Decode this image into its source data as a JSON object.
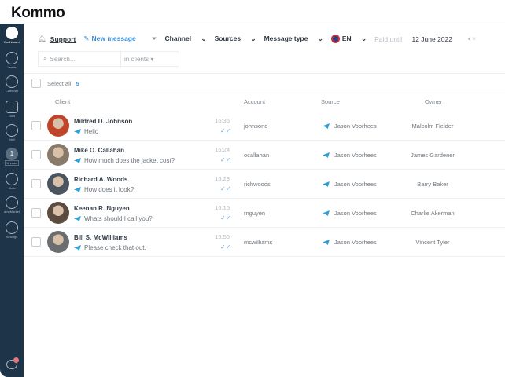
{
  "brand": {
    "logo": "Kommo"
  },
  "sidebar": {
    "items": [
      {
        "label": "Dashboard",
        "icon": "dashboard-icon"
      },
      {
        "label": "Leads",
        "icon": "leads-icon"
      },
      {
        "label": "Calendar",
        "icon": "calendar-icon"
      },
      {
        "label": "Lists",
        "icon": "lists-icon"
      },
      {
        "label": "Mail",
        "icon": "mail-icon"
      },
      {
        "label": "Unread",
        "icon": "unread-icon",
        "badge": "1"
      },
      {
        "label": "Stats",
        "icon": "stats-icon"
      },
      {
        "label": "amoMarket",
        "icon": "market-icon"
      },
      {
        "label": "Settings",
        "icon": "settings-icon"
      }
    ],
    "chat_badge": "1"
  },
  "toolbar": {
    "support": "Support",
    "new_message": "New message",
    "channel": "Channel",
    "sources": "Sources",
    "message_type": "Message type",
    "language": "EN",
    "paid_label": "Paid until",
    "paid_date": "12 June 2022"
  },
  "search": {
    "placeholder": "Search...",
    "scope": "in clients"
  },
  "select_all": {
    "label": "Select all",
    "count": "5"
  },
  "columns": {
    "client": "Client",
    "account": "Account",
    "source": "Source",
    "owner": "Owner"
  },
  "rows": [
    {
      "name": "Mildred D. Johnson",
      "message": "Hello",
      "time": "16:35",
      "account": "johnsond",
      "source": "Jason Voorhees",
      "owner": "Malcolm Fielder",
      "avatar_color": "#c0442a"
    },
    {
      "name": "Mike O. Callahan",
      "message": "How much does the jacket cost?",
      "time": "16:24",
      "account": "ocallahan",
      "source": "Jason Voorhees",
      "owner": "James Gardener",
      "avatar_color": "#8a7a6a"
    },
    {
      "name": "Richard A. Woods",
      "message": "How does it look?",
      "time": "16:23",
      "account": "richwoods",
      "source": "Jason Voorhees",
      "owner": "Barry Baker",
      "avatar_color": "#4a5560"
    },
    {
      "name": "Keenan R. Nguyen",
      "message": "Whats should I call you?",
      "time": "16:15",
      "account": "rnguyen",
      "source": "Jason Voorhees",
      "owner": "Charlie Akerman",
      "avatar_color": "#5b4b40"
    },
    {
      "name": "Bill S. McWilliams",
      "message": "Please check that out.",
      "time": "15:56",
      "account": "mcwilliams",
      "source": "Jason Voorhees",
      "owner": "Vincent Tyler",
      "avatar_color": "#6a6e70"
    }
  ]
}
